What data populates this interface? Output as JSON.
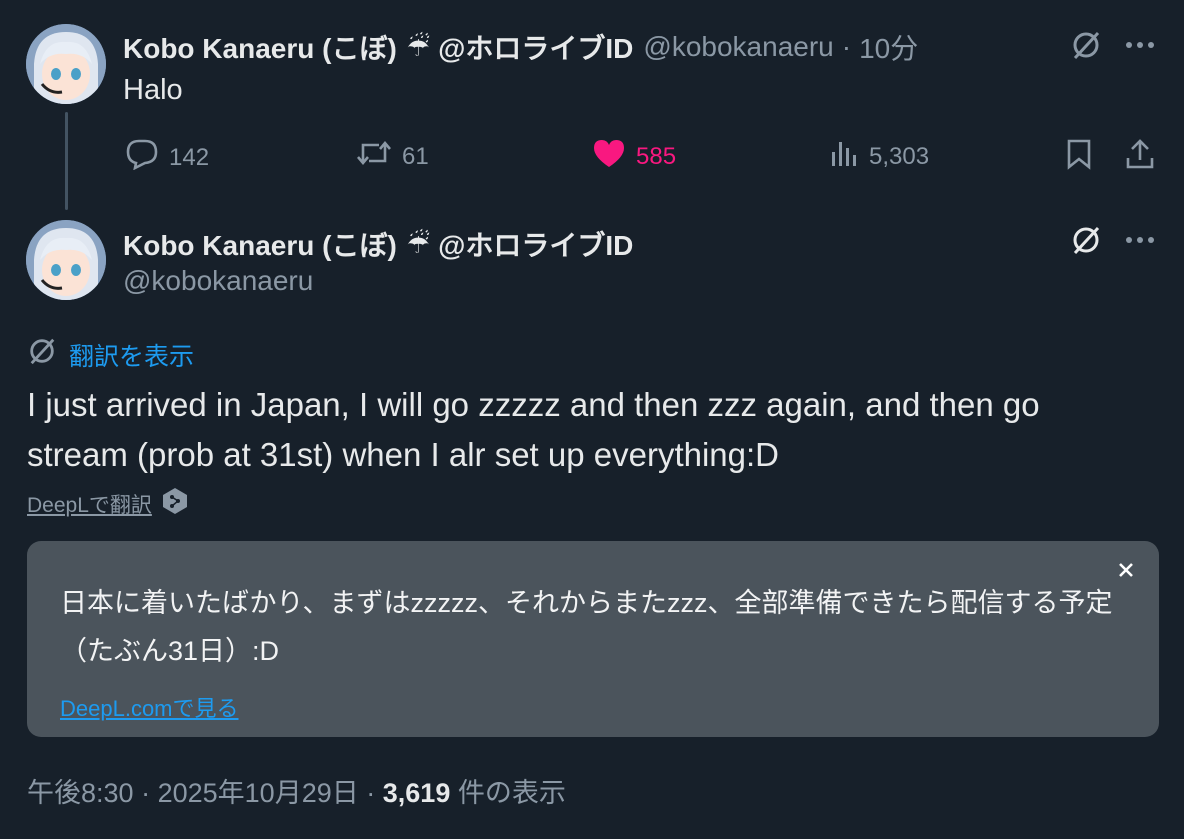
{
  "reply_tweet": {
    "display_name": "Kobo Kanaeru (こぼ)",
    "emoji": "☔",
    "affiliation": "@ホロライブID",
    "handle": "@kobokanaeru",
    "separator": "·",
    "time": "10分",
    "text": "Halo",
    "actions": {
      "replies": "142",
      "reposts": "61",
      "likes": "585",
      "views": "5,303"
    }
  },
  "main_tweet": {
    "display_name": "Kobo Kanaeru (こぼ)",
    "emoji": "☔",
    "affiliation": "@ホロライブID",
    "handle": "@kobokanaeru",
    "translate_label": "翻訳を表示",
    "text": "I just arrived in Japan, I will go zzzzz and then zzz again, and then go stream (prob at 31st) when I alr set up everything:D",
    "deepl_label": "DeepLで翻訳",
    "translation": {
      "text": "日本に着いたばかり、まずはzzzzz、それからまたzzz、全部準備できたら配信する予定（たぶん31日）:D",
      "source_link": "DeepL.comで見る"
    },
    "meta": {
      "time": "午後8:30",
      "separator": "·",
      "date": "2025年10月29日",
      "separator2": "·",
      "views_count": "3,619",
      "views_label": "件の表示"
    }
  },
  "icons": {
    "grok": "grok-icon",
    "more": "more-icon",
    "reply": "reply-icon",
    "repost": "repost-icon",
    "like": "heart-icon",
    "views": "views-icon",
    "bookmark": "bookmark-icon",
    "share": "share-icon",
    "close": "close-icon",
    "deepl": "deepl-icon"
  },
  "colors": {
    "background": "#17202a",
    "accent": "#1d9bf0",
    "like": "#f91880",
    "muted": "#8b98a5",
    "translation_box": "#4b545c"
  }
}
